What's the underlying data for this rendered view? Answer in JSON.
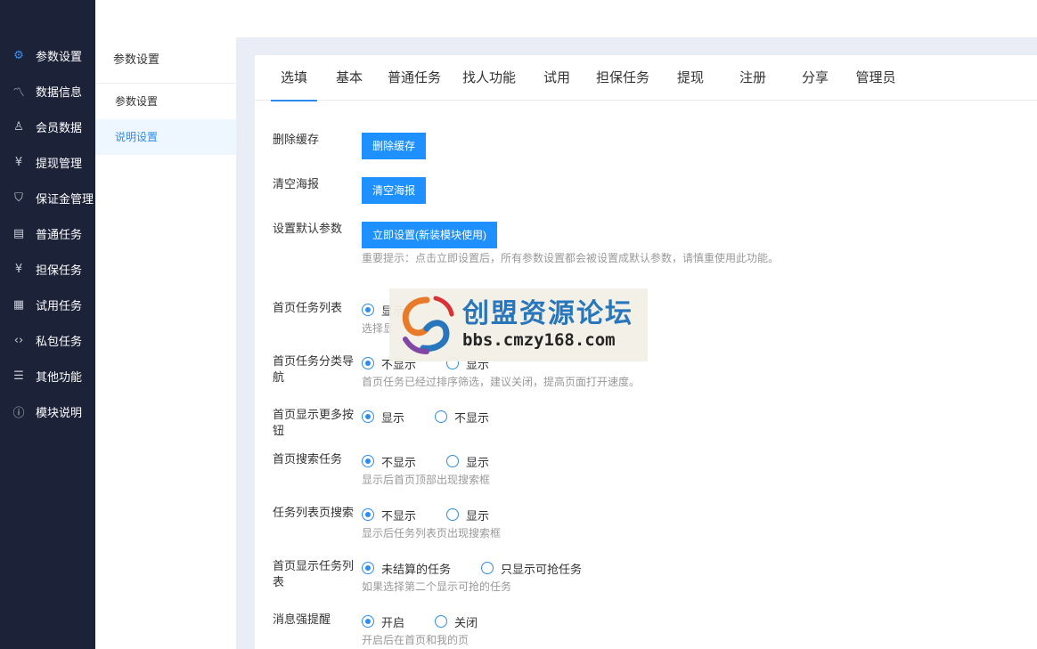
{
  "sidebar": {
    "items": [
      {
        "icon": "gear-icon",
        "glyph": "⚙",
        "label": "参数设置",
        "active": true
      },
      {
        "icon": "chart-icon",
        "glyph": "〽",
        "label": "数据信息"
      },
      {
        "icon": "user-icon",
        "glyph": "♙",
        "label": "会员数据"
      },
      {
        "icon": "yen-icon",
        "glyph": "¥",
        "label": "提现管理"
      },
      {
        "icon": "shield-icon",
        "glyph": "⛉",
        "label": "保证金管理"
      },
      {
        "icon": "receipt-icon",
        "glyph": "▤",
        "label": "普通任务"
      },
      {
        "icon": "guarantee-icon",
        "glyph": "¥",
        "label": "担保任务"
      },
      {
        "icon": "document-icon",
        "glyph": "▦",
        "label": "试用任务"
      },
      {
        "icon": "code-icon",
        "glyph": "‹›",
        "label": "私包任务"
      },
      {
        "icon": "list-icon",
        "glyph": "☰",
        "label": "其他功能"
      },
      {
        "icon": "info-icon",
        "glyph": "ⓘ",
        "label": "模块说明"
      }
    ]
  },
  "submenu": {
    "title": "参数设置",
    "items": [
      {
        "label": "参数设置"
      },
      {
        "label": "说明设置",
        "active": true
      }
    ]
  },
  "tabs": [
    {
      "label": "选填",
      "active": true
    },
    {
      "label": "基本"
    },
    {
      "label": "普通任务"
    },
    {
      "label": "找人功能"
    },
    {
      "label": "试用"
    },
    {
      "label": "担保任务"
    },
    {
      "label": "提现"
    },
    {
      "label": "注册"
    },
    {
      "label": "分享"
    },
    {
      "label": "管理员"
    }
  ],
  "form": {
    "clear_cache": {
      "label": "删除缓存",
      "button": "删除缓存"
    },
    "clear_poster": {
      "label": "清空海报",
      "button": "清空海报"
    },
    "default_params": {
      "label": "设置默认参数",
      "button": "立即设置(新装模块使用)",
      "hint": "重要提示：点击立即设置后，所有参数设置都会被设置成默认参数，请慎重使用此功能。"
    },
    "home_task_list": {
      "label": "首页任务列表",
      "opt1": "显示",
      "hint": "选择显"
    },
    "home_task_nav": {
      "label": "首页任务分类导航",
      "opt1": "不显示",
      "opt2": "显示",
      "hint": "首页任务已经过排序筛选，建议关闭，提高页面打开速度。"
    },
    "home_more_btn": {
      "label": "首页显示更多按钮",
      "opt1": "显示",
      "opt2": "不显示"
    },
    "home_search": {
      "label": "首页搜索任务",
      "opt1": "不显示",
      "opt2": "显示",
      "hint": "显示后首页顶部出现搜索框"
    },
    "list_search": {
      "label": "任务列表页搜索",
      "opt1": "不显示",
      "opt2": "显示",
      "hint": "显示后任务列表页出现搜索框"
    },
    "home_show_list": {
      "label": "首页显示任务列表",
      "opt1": "未结算的任务",
      "opt2": "只显示可抢任务",
      "hint": "如果选择第二个显示可抢的任务"
    },
    "msg_remind": {
      "label": "消息强提醒",
      "opt1": "开启",
      "opt2": "关闭",
      "hint": "开启后在首页和我的页"
    }
  },
  "watermark": {
    "title": "创盟资源论坛",
    "url": "bbs.cmzy168.com"
  }
}
